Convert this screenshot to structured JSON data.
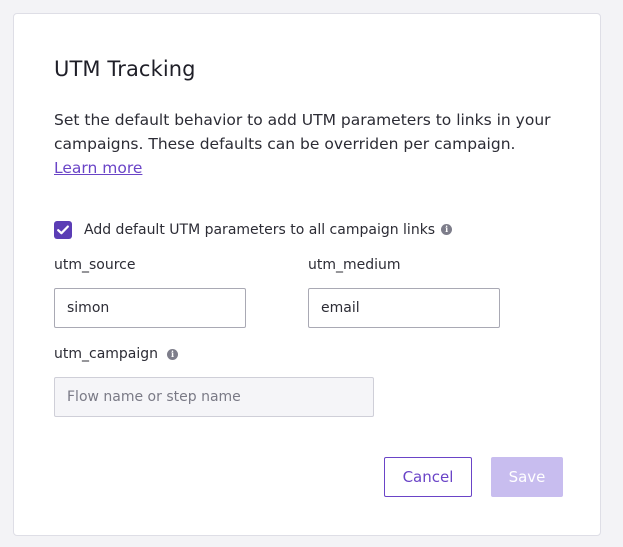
{
  "dialog": {
    "title": "UTM Tracking",
    "description": "Set the default behavior to add UTM parameters to links in your campaigns. These defaults can be overriden per campaign. ",
    "learn_more": "Learn more"
  },
  "default_params": {
    "checked": true,
    "label": "Add default UTM parameters to all campaign links",
    "info_icon": "info-icon"
  },
  "fields": {
    "utm_source": {
      "label": "utm_source",
      "value": "simon"
    },
    "utm_medium": {
      "label": "utm_medium",
      "value": "email"
    },
    "utm_campaign": {
      "label": "utm_campaign",
      "value": "",
      "placeholder": "Flow name or step name"
    }
  },
  "actions": {
    "cancel": "Cancel",
    "save": "Save"
  },
  "colors": {
    "accent": "#6a44c7",
    "checkbox": "#5b3db5",
    "save_disabled": "#c8bdef"
  }
}
